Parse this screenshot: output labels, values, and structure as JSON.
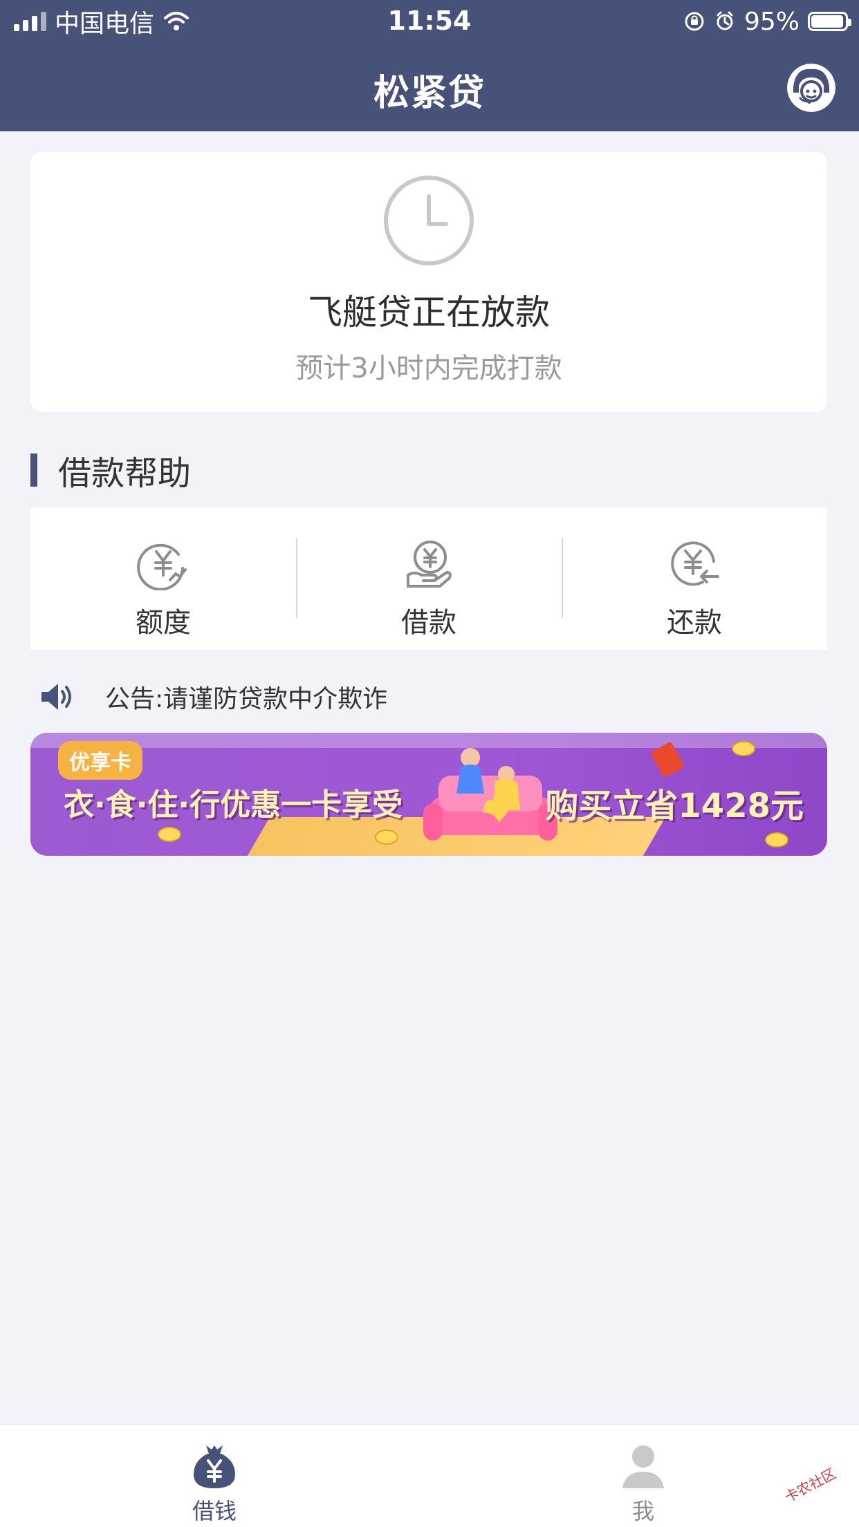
{
  "status_bar": {
    "carrier": "中国电信",
    "time": "11:54",
    "battery": "95%"
  },
  "header": {
    "title": "松紧贷",
    "support_icon": "customer-service-avatar-icon"
  },
  "status_card": {
    "title": "飞艇贷正在放款",
    "subtitle": "预计3小时内完成打款",
    "icon": "clock-icon"
  },
  "help": {
    "title": "借款帮助",
    "items": [
      {
        "label": "额度",
        "icon": "credit-limit-icon"
      },
      {
        "label": "借款",
        "icon": "borrow-icon"
      },
      {
        "label": "还款",
        "icon": "repay-icon"
      }
    ]
  },
  "notice": {
    "text": "公告:请谨防贷款中介欺诈",
    "icon": "speaker-icon"
  },
  "banner": {
    "tag": "优享卡",
    "left_text": "衣·食·住·行优惠一卡享受",
    "right_text": "购买立省1428元",
    "colors": {
      "background": "#9d58d3",
      "text": "#fff2b2",
      "tag": "#f6b243"
    }
  },
  "tabbar": {
    "tabs": [
      {
        "label": "借钱",
        "active": true,
        "icon": "money-bag-icon"
      },
      {
        "label": "我",
        "active": false,
        "icon": "profile-icon"
      }
    ]
  },
  "watermark": {
    "text": "卡农社区"
  },
  "colors": {
    "header": "#465277",
    "page_background": "#f2f3f8",
    "card_background": "#ffffff",
    "accent": "#465277"
  }
}
